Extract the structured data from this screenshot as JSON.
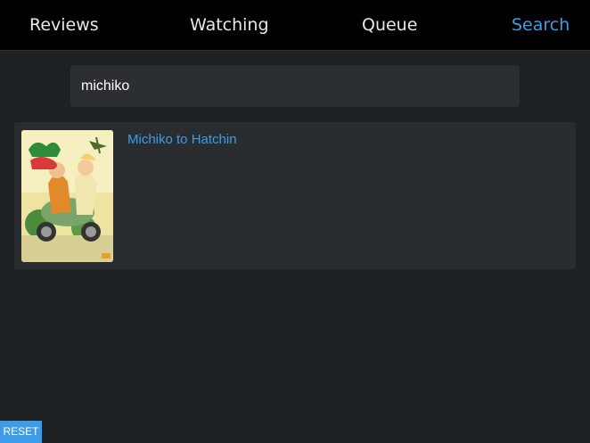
{
  "nav": {
    "items": [
      {
        "label": "Reviews",
        "active": false
      },
      {
        "label": "Watching",
        "active": false
      },
      {
        "label": "Queue",
        "active": false
      },
      {
        "label": "Search",
        "active": true
      }
    ]
  },
  "search": {
    "value": "michiko",
    "placeholder": ""
  },
  "results": [
    {
      "title": "Michiko to Hatchin",
      "poster": "michiko-to-hatchin-cover"
    }
  ],
  "footer": {
    "reset_label": "RESET"
  },
  "colors": {
    "background": "#1e2124",
    "navbar": "#000000",
    "accent": "#3d9ce8",
    "card": "#2a2d30",
    "input": "#2b2e32"
  }
}
